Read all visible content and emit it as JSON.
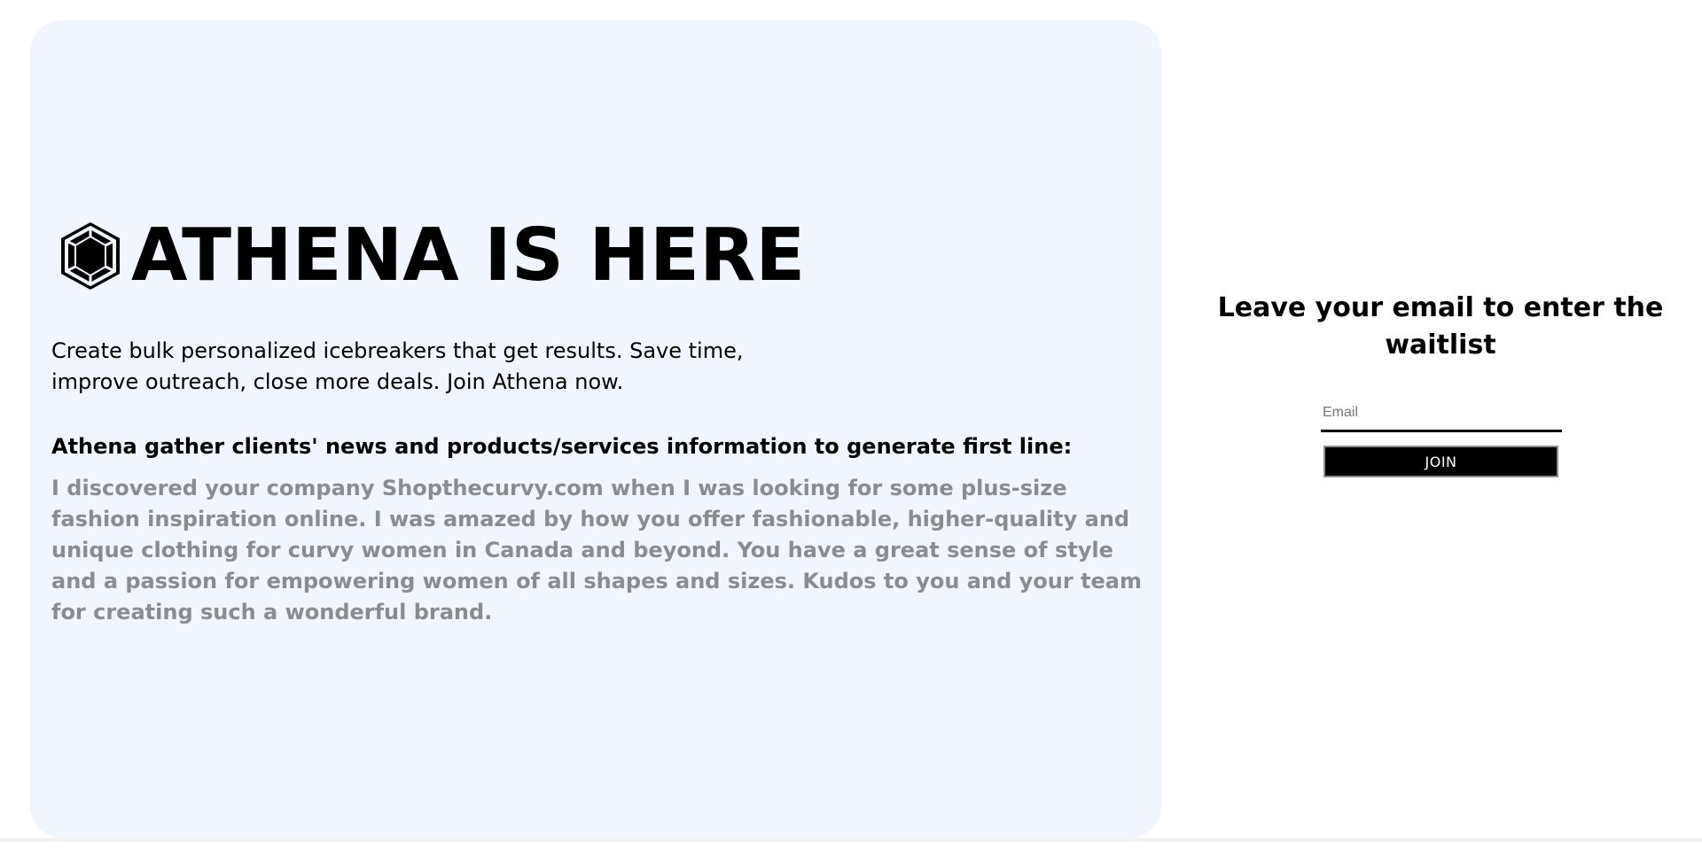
{
  "hero": {
    "title": "ATHENA IS HERE",
    "logo_icon": "hexagon-gem-icon",
    "intro": "Create bulk personalized icebreakers that get results. Save time, improve outreach, close more deals. Join Athena now.",
    "feature_heading": "Athena gather clients' news and products/services information to generate first line:",
    "example_text": "I discovered your company Shopthecurvy.com when I was looking for some plus-size fashion inspiration online. I was amazed by how you offer fashionable, higher-quality and unique clothing for curvy women in Canada and beyond. You have a great sense of style and a passion for empowering women of all shapes and sizes. Kudos to you and your team for creating such a wonderful brand."
  },
  "waitlist": {
    "heading": "Leave your email to enter the waitlist",
    "email_placeholder": "Email",
    "email_value": "",
    "join_label": "JOIN"
  },
  "colors": {
    "panel_background": "#f1f5fd",
    "example_text": "#8a8d90",
    "button_background": "#000000"
  }
}
